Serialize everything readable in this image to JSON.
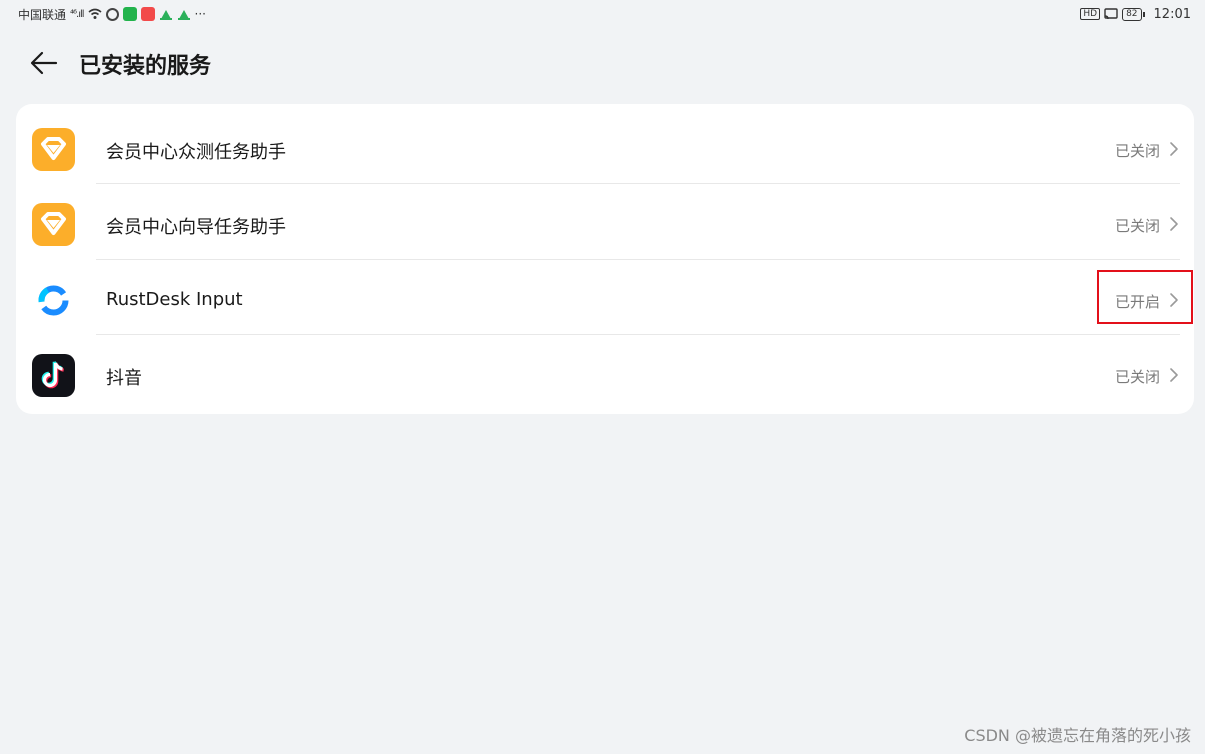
{
  "status_bar": {
    "carrier": "中国联通",
    "signal": "⁴⁶.ıll",
    "more": "···",
    "hd": "HD",
    "battery": "82",
    "time": "12:01"
  },
  "header": {
    "title": "已安装的服务"
  },
  "services": [
    {
      "name": "会员中心众测任务助手",
      "status": "已关闭",
      "icon": "vip-diamond-icon"
    },
    {
      "name": "会员中心向导任务助手",
      "status": "已关闭",
      "icon": "vip-diamond-icon"
    },
    {
      "name": "RustDesk Input",
      "status": "已开启",
      "icon": "rustdesk-icon"
    },
    {
      "name": "抖音",
      "status": "已关闭",
      "icon": "douyin-icon"
    }
  ],
  "colors": {
    "background": "#f1f3f5",
    "card": "#ffffff",
    "highlight": "#e3101a",
    "vip_icon": "#fcae2a"
  },
  "watermark": "CSDN @被遗忘在角落的死小孩"
}
